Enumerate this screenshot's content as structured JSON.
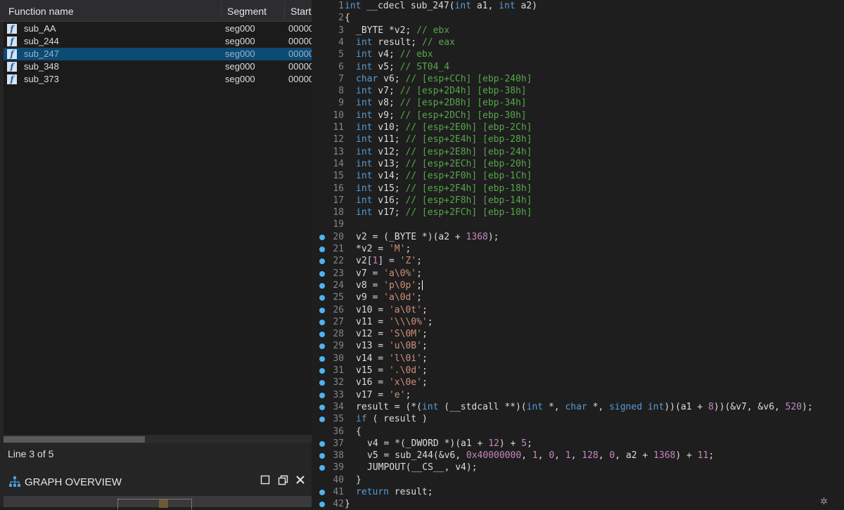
{
  "functions_panel": {
    "columns": {
      "name": "Function name",
      "segment": "Segment",
      "start": "Start"
    },
    "rows": [
      {
        "name": "sub_AA",
        "segment": "seg000",
        "start": "00000"
      },
      {
        "name": "sub_244",
        "segment": "seg000",
        "start": "00000"
      },
      {
        "name": "sub_247",
        "segment": "seg000",
        "start": "00000",
        "selected": true
      },
      {
        "name": "sub_348",
        "segment": "seg000",
        "start": "00000"
      },
      {
        "name": "sub_373",
        "segment": "seg000",
        "start": "00000"
      }
    ],
    "status": "Line 3 of 5"
  },
  "graph_overview": {
    "title": "GRAPH OVERVIEW"
  },
  "code": {
    "lines": [
      {
        "n": "1",
        "dot": false,
        "indent": 0,
        "parts": [
          [
            "k",
            "int"
          ],
          [
            "t",
            " __cdecl sub_247("
          ],
          [
            "k",
            "int"
          ],
          [
            "t",
            " a1, "
          ],
          [
            "k",
            "int"
          ],
          [
            "t",
            " a2)"
          ]
        ]
      },
      {
        "n": "2",
        "dot": false,
        "indent": 0,
        "parts": [
          [
            "t",
            "{"
          ]
        ]
      },
      {
        "n": "3",
        "dot": false,
        "indent": 1,
        "parts": [
          [
            "t",
            "_BYTE *v2; "
          ],
          [
            "c",
            "// ebx"
          ]
        ]
      },
      {
        "n": "4",
        "dot": false,
        "indent": 1,
        "parts": [
          [
            "k",
            "int"
          ],
          [
            "t",
            " result; "
          ],
          [
            "c",
            "// eax"
          ]
        ]
      },
      {
        "n": "5",
        "dot": false,
        "indent": 1,
        "parts": [
          [
            "k",
            "int"
          ],
          [
            "t",
            " v4; "
          ],
          [
            "c",
            "// ebx"
          ]
        ]
      },
      {
        "n": "6",
        "dot": false,
        "indent": 1,
        "parts": [
          [
            "k",
            "int"
          ],
          [
            "t",
            " v5; "
          ],
          [
            "c",
            "// ST04_4"
          ]
        ]
      },
      {
        "n": "7",
        "dot": false,
        "indent": 1,
        "parts": [
          [
            "k",
            "char"
          ],
          [
            "t",
            " v6; "
          ],
          [
            "c",
            "// [esp+CCh] [ebp-240h]"
          ]
        ]
      },
      {
        "n": "8",
        "dot": false,
        "indent": 1,
        "parts": [
          [
            "k",
            "int"
          ],
          [
            "t",
            " v7; "
          ],
          [
            "c",
            "// [esp+2D4h] [ebp-38h]"
          ]
        ]
      },
      {
        "n": "9",
        "dot": false,
        "indent": 1,
        "parts": [
          [
            "k",
            "int"
          ],
          [
            "t",
            " v8; "
          ],
          [
            "c",
            "// [esp+2D8h] [ebp-34h]"
          ]
        ]
      },
      {
        "n": "10",
        "dot": false,
        "indent": 1,
        "parts": [
          [
            "k",
            "int"
          ],
          [
            "t",
            " v9; "
          ],
          [
            "c",
            "// [esp+2DCh] [ebp-30h]"
          ]
        ]
      },
      {
        "n": "11",
        "dot": false,
        "indent": 1,
        "parts": [
          [
            "k",
            "int"
          ],
          [
            "t",
            " v10; "
          ],
          [
            "c",
            "// [esp+2E0h] [ebp-2Ch]"
          ]
        ]
      },
      {
        "n": "12",
        "dot": false,
        "indent": 1,
        "parts": [
          [
            "k",
            "int"
          ],
          [
            "t",
            " v11; "
          ],
          [
            "c",
            "// [esp+2E4h] [ebp-28h]"
          ]
        ]
      },
      {
        "n": "13",
        "dot": false,
        "indent": 1,
        "parts": [
          [
            "k",
            "int"
          ],
          [
            "t",
            " v12; "
          ],
          [
            "c",
            "// [esp+2E8h] [ebp-24h]"
          ]
        ]
      },
      {
        "n": "14",
        "dot": false,
        "indent": 1,
        "parts": [
          [
            "k",
            "int"
          ],
          [
            "t",
            " v13; "
          ],
          [
            "c",
            "// [esp+2ECh] [ebp-20h]"
          ]
        ]
      },
      {
        "n": "15",
        "dot": false,
        "indent": 1,
        "parts": [
          [
            "k",
            "int"
          ],
          [
            "t",
            " v14; "
          ],
          [
            "c",
            "// [esp+2F0h] [ebp-1Ch]"
          ]
        ]
      },
      {
        "n": "16",
        "dot": false,
        "indent": 1,
        "parts": [
          [
            "k",
            "int"
          ],
          [
            "t",
            " v15; "
          ],
          [
            "c",
            "// [esp+2F4h] [ebp-18h]"
          ]
        ]
      },
      {
        "n": "17",
        "dot": false,
        "indent": 1,
        "parts": [
          [
            "k",
            "int"
          ],
          [
            "t",
            " v16; "
          ],
          [
            "c",
            "// [esp+2F8h] [ebp-14h]"
          ]
        ]
      },
      {
        "n": "18",
        "dot": false,
        "indent": 1,
        "parts": [
          [
            "k",
            "int"
          ],
          [
            "t",
            " v17; "
          ],
          [
            "c",
            "// [esp+2FCh] [ebp-10h]"
          ]
        ]
      },
      {
        "n": "19",
        "dot": false,
        "indent": 0,
        "parts": []
      },
      {
        "n": "20",
        "dot": true,
        "indent": 1,
        "parts": [
          [
            "t",
            "v2 = (_BYTE *)(a2 + "
          ],
          [
            "n",
            "1368"
          ],
          [
            "t",
            ");"
          ]
        ]
      },
      {
        "n": "21",
        "dot": true,
        "indent": 1,
        "parts": [
          [
            "t",
            "*v2 = "
          ],
          [
            "s",
            "'M'"
          ],
          [
            "t",
            ";"
          ]
        ]
      },
      {
        "n": "22",
        "dot": true,
        "indent": 1,
        "parts": [
          [
            "t",
            "v2["
          ],
          [
            "n",
            "1"
          ],
          [
            "t",
            "] = "
          ],
          [
            "s",
            "'Z'"
          ],
          [
            "t",
            ";"
          ]
        ]
      },
      {
        "n": "23",
        "dot": true,
        "indent": 1,
        "parts": [
          [
            "t",
            "v7 = "
          ],
          [
            "s",
            "'a\\0%'"
          ],
          [
            "t",
            ";"
          ]
        ]
      },
      {
        "n": "24",
        "dot": true,
        "indent": 1,
        "parts": [
          [
            "t",
            "v8 = "
          ],
          [
            "s",
            "'p\\0p'"
          ],
          [
            "t",
            ";"
          ]
        ],
        "cursor": true
      },
      {
        "n": "25",
        "dot": true,
        "indent": 1,
        "parts": [
          [
            "t",
            "v9 = "
          ],
          [
            "s",
            "'a\\0d'"
          ],
          [
            "t",
            ";"
          ]
        ]
      },
      {
        "n": "26",
        "dot": true,
        "indent": 1,
        "parts": [
          [
            "t",
            "v10 = "
          ],
          [
            "s",
            "'a\\0t'"
          ],
          [
            "t",
            ";"
          ]
        ]
      },
      {
        "n": "27",
        "dot": true,
        "indent": 1,
        "parts": [
          [
            "t",
            "v11 = "
          ],
          [
            "s",
            "'\\\\\\0%'"
          ],
          [
            "t",
            ";"
          ]
        ]
      },
      {
        "n": "28",
        "dot": true,
        "indent": 1,
        "parts": [
          [
            "t",
            "v12 = "
          ],
          [
            "s",
            "'S\\0M'"
          ],
          [
            "t",
            ";"
          ]
        ]
      },
      {
        "n": "29",
        "dot": true,
        "indent": 1,
        "parts": [
          [
            "t",
            "v13 = "
          ],
          [
            "s",
            "'u\\0B'"
          ],
          [
            "t",
            ";"
          ]
        ]
      },
      {
        "n": "30",
        "dot": true,
        "indent": 1,
        "parts": [
          [
            "t",
            "v14 = "
          ],
          [
            "s",
            "'l\\0i'"
          ],
          [
            "t",
            ";"
          ]
        ]
      },
      {
        "n": "31",
        "dot": true,
        "indent": 1,
        "parts": [
          [
            "t",
            "v15 = "
          ],
          [
            "s",
            "'.\\0d'"
          ],
          [
            "t",
            ";"
          ]
        ]
      },
      {
        "n": "32",
        "dot": true,
        "indent": 1,
        "parts": [
          [
            "t",
            "v16 = "
          ],
          [
            "s",
            "'x\\0e'"
          ],
          [
            "t",
            ";"
          ]
        ]
      },
      {
        "n": "33",
        "dot": true,
        "indent": 1,
        "parts": [
          [
            "t",
            "v17 = "
          ],
          [
            "s",
            "'e'"
          ],
          [
            "t",
            ";"
          ]
        ]
      },
      {
        "n": "34",
        "dot": true,
        "indent": 1,
        "parts": [
          [
            "t",
            "result = (*("
          ],
          [
            "k",
            "int"
          ],
          [
            "t",
            " (__stdcall **)("
          ],
          [
            "k",
            "int"
          ],
          [
            "t",
            " *, "
          ],
          [
            "k",
            "char"
          ],
          [
            "t",
            " *, "
          ],
          [
            "k",
            "signed int"
          ],
          [
            "t",
            "))(a1 + "
          ],
          [
            "n",
            "8"
          ],
          [
            "t",
            "))(&v7, &v6, "
          ],
          [
            "n",
            "520"
          ],
          [
            "t",
            ");"
          ]
        ]
      },
      {
        "n": "35",
        "dot": true,
        "indent": 1,
        "parts": [
          [
            "k",
            "if"
          ],
          [
            "t",
            " ( result )"
          ]
        ]
      },
      {
        "n": "36",
        "dot": false,
        "indent": 1,
        "parts": [
          [
            "t",
            "{"
          ]
        ]
      },
      {
        "n": "37",
        "dot": true,
        "indent": 2,
        "parts": [
          [
            "t",
            "v4 = *(_DWORD *)(a1 + "
          ],
          [
            "n",
            "12"
          ],
          [
            "t",
            ") + "
          ],
          [
            "n",
            "5"
          ],
          [
            "t",
            ";"
          ]
        ]
      },
      {
        "n": "38",
        "dot": true,
        "indent": 2,
        "parts": [
          [
            "t",
            "v5 = sub_244(&v6, "
          ],
          [
            "n",
            "0x40000000"
          ],
          [
            "t",
            ", "
          ],
          [
            "n",
            "1"
          ],
          [
            "t",
            ", "
          ],
          [
            "n",
            "0"
          ],
          [
            "t",
            ", "
          ],
          [
            "n",
            "1"
          ],
          [
            "t",
            ", "
          ],
          [
            "n",
            "128"
          ],
          [
            "t",
            ", "
          ],
          [
            "n",
            "0"
          ],
          [
            "t",
            ", a2 + "
          ],
          [
            "n",
            "1368"
          ],
          [
            "t",
            ") + "
          ],
          [
            "n",
            "11"
          ],
          [
            "t",
            ";"
          ]
        ]
      },
      {
        "n": "39",
        "dot": true,
        "indent": 2,
        "parts": [
          [
            "t",
            "JUMPOUT(__CS__, v4);"
          ]
        ]
      },
      {
        "n": "40",
        "dot": false,
        "indent": 1,
        "parts": [
          [
            "t",
            "}"
          ]
        ]
      },
      {
        "n": "41",
        "dot": true,
        "indent": 1,
        "parts": [
          [
            "k",
            "return"
          ],
          [
            "t",
            " result;"
          ]
        ]
      },
      {
        "n": "42",
        "dot": true,
        "indent": 0,
        "parts": [
          [
            "t",
            "}"
          ]
        ]
      }
    ]
  },
  "icons": {
    "function": "function-icon",
    "graph": "graph-overview-icon",
    "corner": "gear-icon"
  },
  "colors": {
    "selection": "#0d4a74",
    "breakpoint_dot": "#4fb3f0",
    "keyword": "#569cd6",
    "string": "#ce9178",
    "number": "#c586c0",
    "comment": "#57a64a"
  }
}
